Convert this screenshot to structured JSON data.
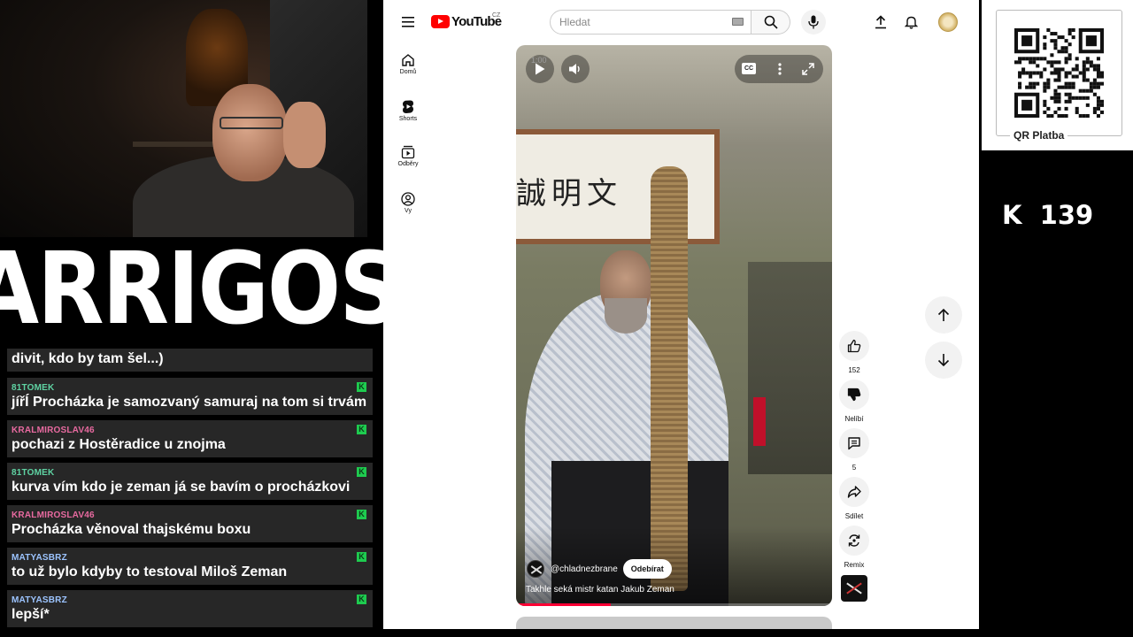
{
  "youtube": {
    "logo_text": "YouTube",
    "country_code": "CZ",
    "search_placeholder": "Hledat",
    "nav": [
      {
        "label": "Domů",
        "icon": "home-icon"
      },
      {
        "label": "Shorts",
        "icon": "shorts-icon"
      },
      {
        "label": "Odběry",
        "icon": "subscriptions-icon"
      },
      {
        "label": "Vy",
        "icon": "you-icon"
      }
    ],
    "short": {
      "time": "1:00",
      "channel": "@chladnezbrane",
      "subscribe_label": "Odebírat",
      "title": "Takhle seká mistr katan Jakub Zeman",
      "progress": 0.3
    },
    "actions": {
      "like_count": "152",
      "dislike_label": "Nelíbí",
      "comment_count": "5",
      "share_label": "Sdílet",
      "remix_label": "Remix"
    }
  },
  "stream": {
    "logo_text": "ARRIGOS",
    "qr_label": "QR Platba",
    "counter": "K  139"
  },
  "chat": {
    "first_line": "divit, kdo by tam šel...)",
    "messages": [
      {
        "user": "81TOMEK",
        "text": "jířÍ Procházka je samozvaný samuraj na tom si trvám",
        "color": "#5fd3a3"
      },
      {
        "user": "KRALMIROSLAV46",
        "text": "pochazi z Hostěradice u znojma",
        "color": "#e86aa0"
      },
      {
        "user": "81TOMEK",
        "text": "kurva vím kdo je zeman já se bavím o procházkovi",
        "color": "#5fd3a3"
      },
      {
        "user": "KRALMIROSLAV46",
        "text": "Procházka věnoval thajskému boxu",
        "color": "#e86aa0"
      },
      {
        "user": "MATYASBRZ",
        "text": "to už bylo kdyby to testoval Miloš Zeman",
        "color": "#9cc4ff"
      },
      {
        "user": "MATYASBRZ",
        "text": "lepší*",
        "color": "#9cc4ff"
      }
    ]
  }
}
